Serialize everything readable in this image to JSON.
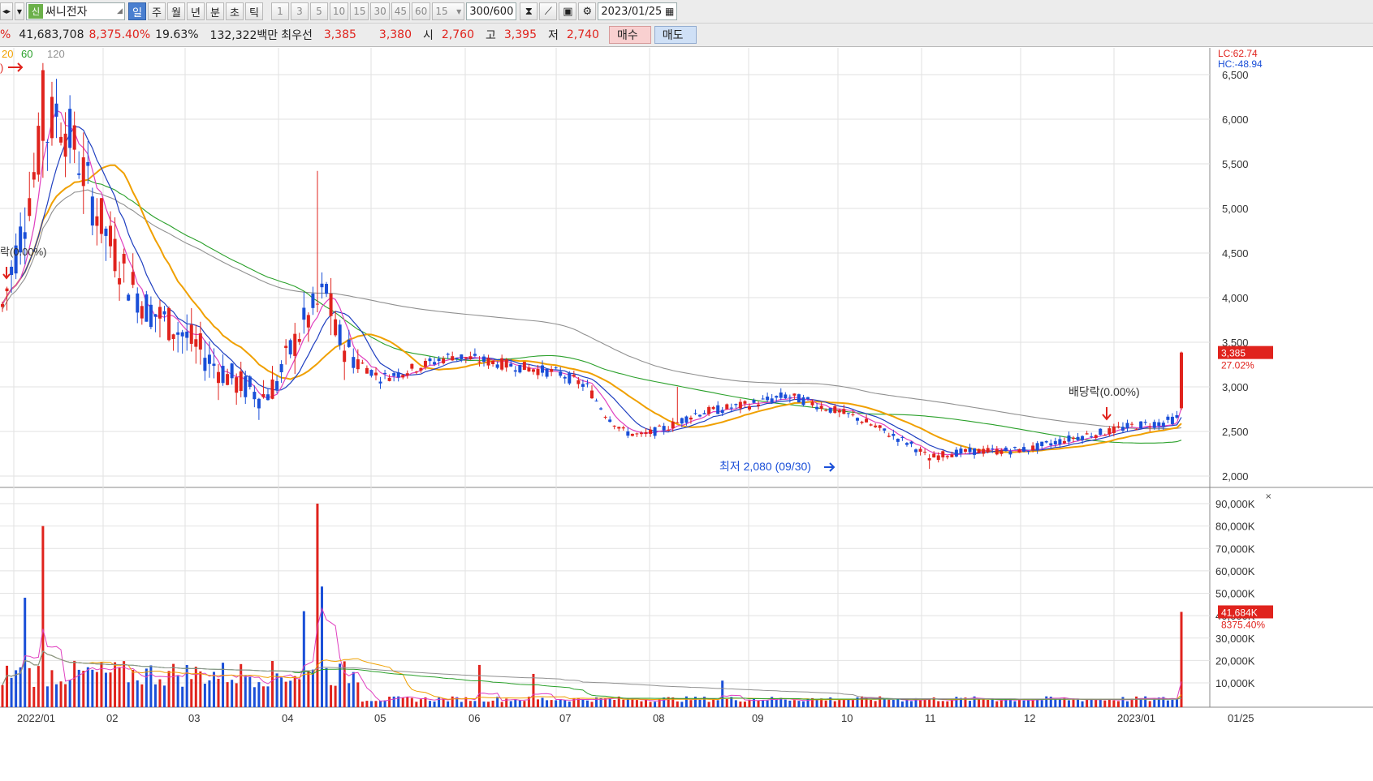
{
  "toolbar": {
    "stock_badge": "신",
    "stock_name": "써니전자",
    "periods": [
      "일",
      "주",
      "월",
      "년",
      "분",
      "초",
      "틱"
    ],
    "selected_period": "일",
    "intervals": [
      "1",
      "3",
      "5",
      "10",
      "15",
      "30",
      "45",
      "60"
    ],
    "interval_select": "15",
    "count": "300",
    "count_max": "/600",
    "date": "2023/01/25"
  },
  "quote": {
    "pct_prefix": "%",
    "volume": "41,683,708",
    "volume_change": "8,375.40%",
    "turnover": "19.63%",
    "amount": "132,322백만",
    "best_ask_label": "최우선",
    "best_ask": "3,385",
    "best_bid": "3,380",
    "open_label": "시",
    "open": "2,760",
    "high_label": "고",
    "high": "3,395",
    "low_label": "저",
    "low": "2,740",
    "buy_label": "매수",
    "sell_label": "매도"
  },
  "ma_legend": [
    "20",
    "60",
    "120"
  ],
  "annotations": {
    "top_left_marker": ")",
    "left_event": "락(0.00%)",
    "dividend_event": "배당락(0.00%)",
    "low_marker": "최저 2,080 (09/30)"
  },
  "price_axis": {
    "lc": "LC:62.74",
    "hc": "HC:-48.94",
    "ticks": [
      "6,500",
      "6,000",
      "5,500",
      "5,000",
      "4,500",
      "4,000",
      "3,500",
      "3,000",
      "2,500",
      "2,000"
    ],
    "current_price": "3,385",
    "current_change": "27.02%"
  },
  "volume_axis": {
    "ticks": [
      "90,000K",
      "80,000K",
      "70,000K",
      "60,000K",
      "50,000K",
      "40,000K",
      "30,000K",
      "20,000K",
      "10,000K"
    ],
    "current_volume": "41,684K",
    "current_volume_change": "8375.40%"
  },
  "time_axis": {
    "labels": [
      "2022/01",
      "02",
      "03",
      "04",
      "05",
      "06",
      "07",
      "08",
      "09",
      "10",
      "11",
      "12",
      "2023/01"
    ],
    "right_label": "01/25"
  },
  "colors": {
    "up": "#e0231d",
    "down": "#1a4fd8",
    "ma5": "#e040c0",
    "ma10": "#1f3fc0",
    "ma20": "#f0a000",
    "ma60": "#2aa02a",
    "ma120": "#909090"
  },
  "chart_data": {
    "type": "candlestick",
    "ylim": [
      2000,
      6600
    ],
    "key_points": [
      {
        "date": "2022/01",
        "price": 6600,
        "note": "peak"
      },
      {
        "date": "2022/03",
        "price": 5400,
        "note": "spike high"
      },
      {
        "date": "2022/09/30",
        "price": 2080,
        "note": "최저"
      },
      {
        "date": "2023/01/25",
        "open": 2760,
        "high": 3395,
        "low": 2740,
        "close": 3385
      }
    ],
    "volume_ylim": [
      0,
      95000
    ],
    "last_volume_k": 41684
  }
}
